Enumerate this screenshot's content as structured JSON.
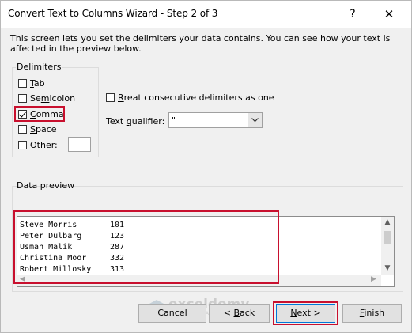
{
  "window": {
    "title": "Convert Text to Columns Wizard - Step 2 of 3",
    "help_label": "?",
    "close_label": "✕"
  },
  "description": "This screen lets you set the delimiters your data contains.  You can see how your text is affected in the preview below.",
  "delimiters": {
    "label": "Delimiters",
    "items": [
      {
        "prefix": "",
        "mnemonic": "T",
        "suffix": "ab",
        "checked": false
      },
      {
        "prefix": "Se",
        "mnemonic": "m",
        "suffix": "icolon",
        "checked": false
      },
      {
        "prefix": "",
        "mnemonic": "C",
        "suffix": "omma",
        "checked": true
      },
      {
        "prefix": "",
        "mnemonic": "S",
        "suffix": "pace",
        "checked": false
      },
      {
        "prefix": "",
        "mnemonic": "O",
        "suffix": "ther:",
        "checked": false
      }
    ],
    "other_value": ""
  },
  "options": {
    "treat_consecutive": {
      "mnemonic": "R",
      "rest": "reat consecutive delimiters as one",
      "checked": false
    },
    "qualifier_label_prefix": "Text ",
    "qualifier_label_mnemonic": "q",
    "qualifier_label_suffix": "ualifier:",
    "qualifier_value": "\""
  },
  "preview": {
    "label": "Data preview",
    "rows": [
      {
        "name": "Steve Morris",
        "value": "101"
      },
      {
        "name": "Peter Dulbarg",
        "value": "123"
      },
      {
        "name": "Usman Malik",
        "value": "287"
      },
      {
        "name": "Christina Moor",
        "value": "332"
      },
      {
        "name": "Robert Millosky",
        "value": "313"
      }
    ]
  },
  "buttons": {
    "cancel": "Cancel",
    "back_mnemonic": "B",
    "back_prefix": "< ",
    "back_suffix": "ack",
    "next_mnemonic": "N",
    "next_suffix": "ext >",
    "finish_mnemonic": "F",
    "finish_suffix": "inish"
  },
  "watermark": {
    "name": "exceldemy",
    "tagline": "EXCEL · DATA · BI"
  },
  "colors": {
    "highlight": "#c8102e",
    "default_button_border": "#0078d7"
  }
}
